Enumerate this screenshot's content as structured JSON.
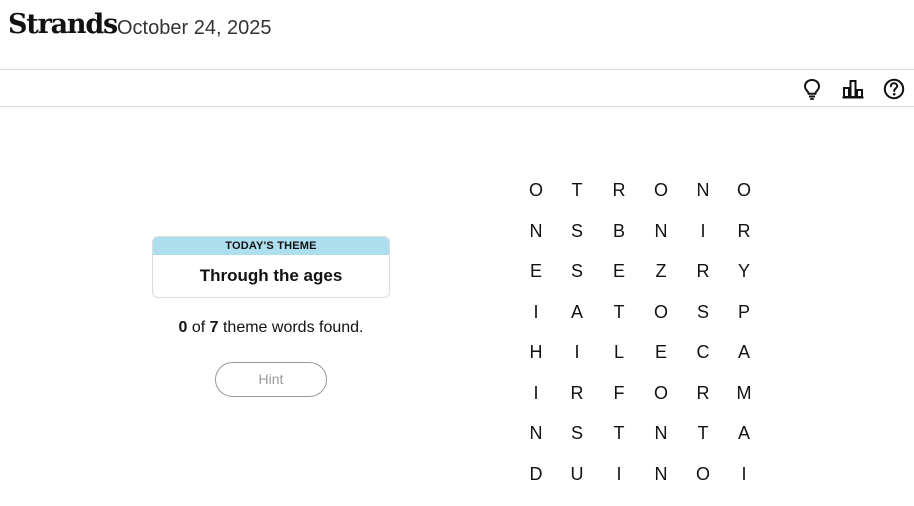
{
  "header": {
    "brand": "Strands",
    "date": "October 24, 2025"
  },
  "toolbar": {
    "icons": [
      "lightbulb-icon",
      "stats-icon",
      "help-icon"
    ]
  },
  "theme": {
    "label": "TODAY'S THEME",
    "title": "Through the ages"
  },
  "progress": {
    "found": "0",
    "of_text": " of ",
    "total": "7",
    "suffix": " theme words found."
  },
  "hint": {
    "label": "Hint"
  },
  "grid": {
    "rows": [
      [
        "O",
        "T",
        "R",
        "O",
        "N",
        "O"
      ],
      [
        "N",
        "S",
        "B",
        "N",
        "I",
        "R"
      ],
      [
        "E",
        "S",
        "E",
        "Z",
        "R",
        "Y"
      ],
      [
        "I",
        "A",
        "T",
        "O",
        "S",
        "P"
      ],
      [
        "H",
        "I",
        "L",
        "E",
        "C",
        "A"
      ],
      [
        "I",
        "R",
        "F",
        "O",
        "R",
        "M"
      ],
      [
        "N",
        "S",
        "T",
        "N",
        "T",
        "A"
      ],
      [
        "D",
        "U",
        "I",
        "N",
        "O",
        "I"
      ]
    ]
  },
  "colors": {
    "theme_label_bg": "#aedfee",
    "border": "#dcdcdc",
    "text": "#121212"
  }
}
